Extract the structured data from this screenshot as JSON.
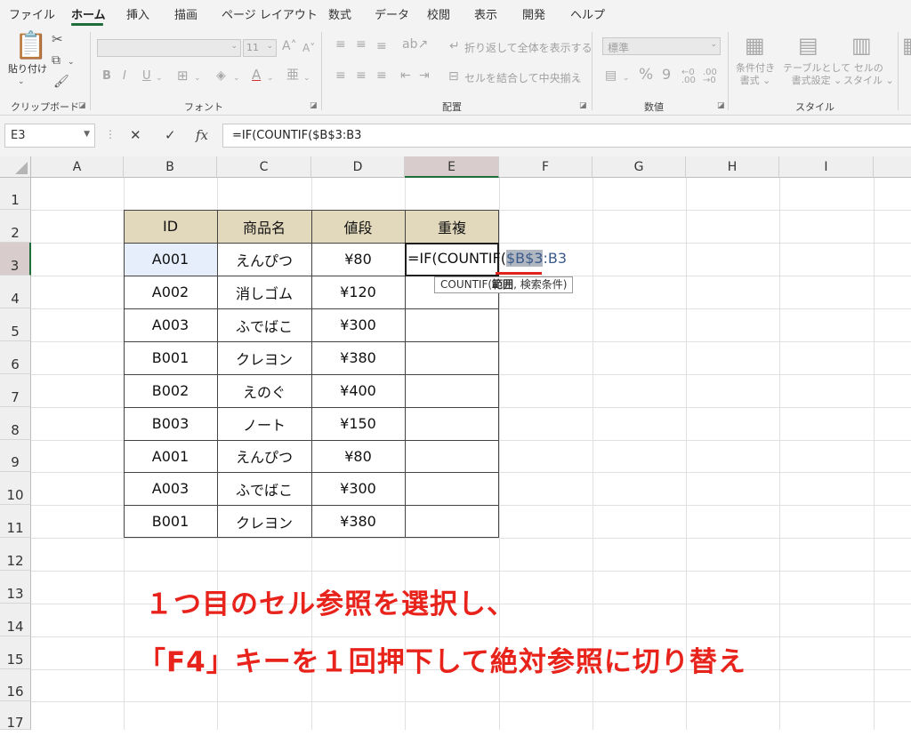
{
  "menu": {
    "tabs": [
      "ファイル",
      "ホーム",
      "挿入",
      "描画",
      "ページ レイアウト",
      "数式",
      "データ",
      "校閲",
      "表示",
      "開発",
      "ヘルプ"
    ],
    "active_tab": "ホーム"
  },
  "ribbon": {
    "clipboard": {
      "label": "クリップボード",
      "paste": "貼り付け"
    },
    "font": {
      "label": "フォント",
      "size": "11",
      "bold": "B",
      "italic": "I",
      "underline": "U"
    },
    "alignment": {
      "label": "配置",
      "wrap_text": "折り返して全体を表示する",
      "merge_center": "セルを結合して中央揃え"
    },
    "number": {
      "label": "数値",
      "format": "標準"
    },
    "styles": {
      "label": "スタイル",
      "conditional": [
        "条件付き",
        "書式"
      ],
      "table": [
        "テーブルとして",
        "書式設定"
      ],
      "cell": [
        "セルの",
        "スタイル"
      ]
    }
  },
  "formula_bar": {
    "name_box": "E3",
    "cancel_icon": "✕",
    "enter_icon": "✓",
    "fx": "fx",
    "content": "=IF(COUNTIF($B$3:B3"
  },
  "grid": {
    "columns": [
      "A",
      "B",
      "C",
      "D",
      "E",
      "F",
      "G",
      "H",
      "I"
    ],
    "rows": [
      "1",
      "2",
      "3",
      "4",
      "5",
      "6",
      "7",
      "8",
      "9",
      "10",
      "11",
      "12",
      "13",
      "14",
      "15",
      "16",
      "17"
    ],
    "selected_column": "E",
    "selected_row": "3"
  },
  "table": {
    "headers": [
      "ID",
      "商品名",
      "値段",
      "重複"
    ],
    "rows": [
      [
        "A001",
        "えんぴつ",
        "¥80"
      ],
      [
        "A002",
        "消しゴム",
        "¥120"
      ],
      [
        "A003",
        "ふでばこ",
        "¥300"
      ],
      [
        "B001",
        "クレヨン",
        "¥380"
      ],
      [
        "B002",
        "えのぐ",
        "¥400"
      ],
      [
        "B003",
        "ノート",
        "¥150"
      ],
      [
        "A001",
        "えんぴつ",
        "¥80"
      ],
      [
        "A003",
        "ふでばこ",
        "¥300"
      ],
      [
        "B001",
        "クレヨン",
        "¥380"
      ]
    ]
  },
  "edit_cell": {
    "prefix": "=IF(COUNTIF(",
    "ref_selected": "$B$3",
    "suffix": ":B3",
    "tooltip_fn": "COUNTIF(",
    "tooltip_arg1": "範囲",
    "tooltip_rest": ", 検索条件)"
  },
  "annotation": {
    "line1": "１つ目のセル参照を選択し、",
    "line2": "「F4」キーを１回押下して絶対参照に切り替え"
  },
  "colors": {
    "accent_green": "#1e6e3c",
    "header_fill": "#e2d9bd",
    "annotation_red": "#e8231b",
    "selected_cell_fill": "#e6eefb"
  }
}
